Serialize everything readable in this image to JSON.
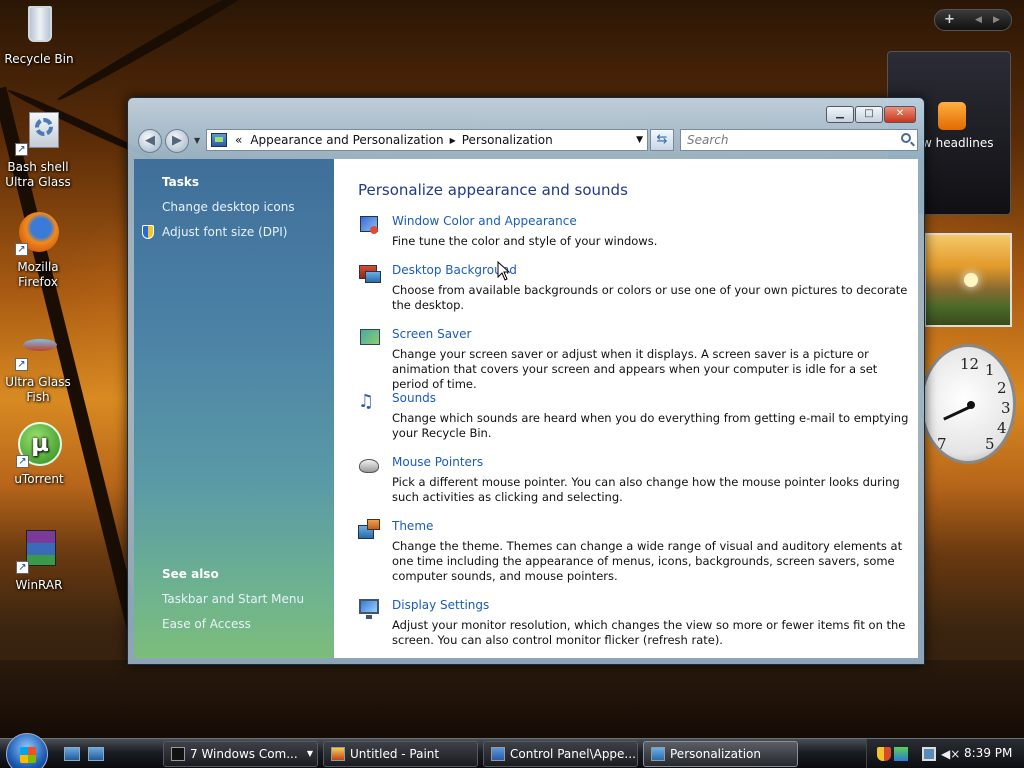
{
  "desktop": {
    "icons": [
      {
        "label": "Recycle Bin"
      },
      {
        "label": "Bash shell\nUltra Glass"
      },
      {
        "label": "Mozilla\nFirefox"
      },
      {
        "label": "Ultra Glass\nFish"
      },
      {
        "label": "uTorrent"
      },
      {
        "label": "WinRAR"
      }
    ]
  },
  "sidebar": {
    "feed_text": "w headlines",
    "clock_numbers": [
      "12",
      "1",
      "2",
      "3",
      "4",
      "5",
      "7"
    ]
  },
  "window": {
    "address": {
      "chevron": "«",
      "segments": [
        "Appearance and Personalization",
        "Personalization"
      ]
    },
    "search_placeholder": "Search",
    "tasks": {
      "heading": "Tasks",
      "links": [
        "Change desktop icons",
        "Adjust font size (DPI)"
      ]
    },
    "see_also": {
      "heading": "See also",
      "links": [
        "Taskbar and Start Menu",
        "Ease of Access"
      ]
    },
    "title": "Personalize appearance and sounds",
    "items": [
      {
        "link": "Window Color and Appearance",
        "desc": "Fine tune the color and style of your windows.",
        "icon": "window-color-icon"
      },
      {
        "link": "Desktop Background",
        "desc": "Choose from available backgrounds or colors or use one of your own pictures to decorate the desktop.",
        "icon": "desktop-background-icon"
      },
      {
        "link": "Screen Saver",
        "desc": "Change your screen saver or adjust when it displays. A screen saver is a picture or animation that covers your screen and appears when your computer is idle for a set period of time.",
        "icon": "screen-saver-icon"
      },
      {
        "link": "Sounds",
        "desc": "Change which sounds are heard when you do everything from getting e-mail to emptying your Recycle Bin.",
        "icon": "sounds-icon"
      },
      {
        "link": "Mouse Pointers",
        "desc": "Pick a different mouse pointer. You can also change how the mouse pointer looks during such activities as clicking and selecting.",
        "icon": "mouse-pointer-icon"
      },
      {
        "link": "Theme",
        "desc": "Change the theme. Themes can change a wide range of visual and auditory elements at one time including the appearance of menus, icons, backgrounds, screen savers, some computer sounds, and mouse pointers.",
        "icon": "theme-icon"
      },
      {
        "link": "Display Settings",
        "desc": "Adjust your monitor resolution, which changes the view so more or fewer items fit on the screen. You can also control monitor flicker (refresh rate).",
        "icon": "display-settings-icon"
      }
    ]
  },
  "taskbar": {
    "buttons": [
      {
        "label": "7 Windows Com...",
        "active": false
      },
      {
        "label": "Untitled - Paint",
        "active": false
      },
      {
        "label": "Control Panel\\Appe...",
        "active": false
      },
      {
        "label": "Personalization",
        "active": true
      }
    ],
    "time": "8:39 PM"
  }
}
